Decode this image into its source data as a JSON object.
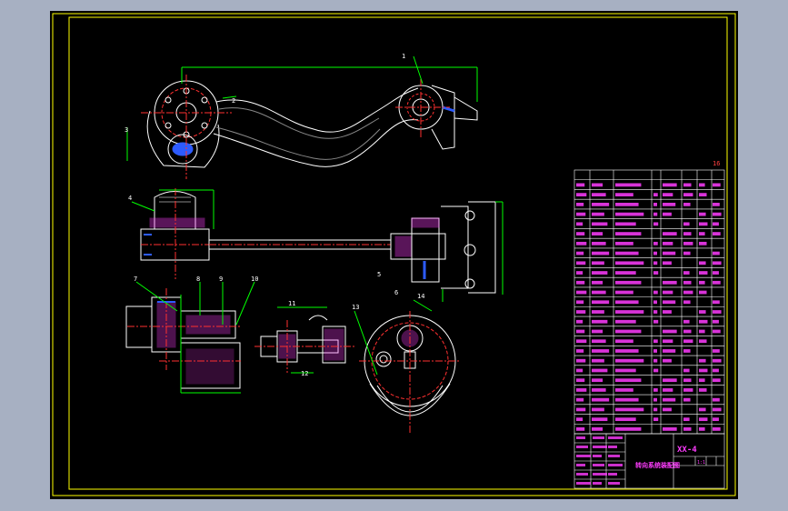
{
  "colors": {
    "background": "#a7b0c2",
    "canvas": "#000000",
    "frame": "#ffff00",
    "outline": "#ffffff",
    "dimension": "#00ff00",
    "center_line": "#ff3030",
    "hidden_line": "#2d5bff",
    "table_text": "#ff3cff",
    "hatch": "#ff3cff"
  },
  "callouts": [
    "1",
    "2",
    "3",
    "4",
    "5",
    "6",
    "7",
    "8",
    "9",
    "10",
    "11",
    "12",
    "13",
    "14"
  ],
  "page_tag": "16",
  "title_block": {
    "drawing_number": "XX-4",
    "title": "转向系统装配图",
    "scale": "1:1"
  }
}
